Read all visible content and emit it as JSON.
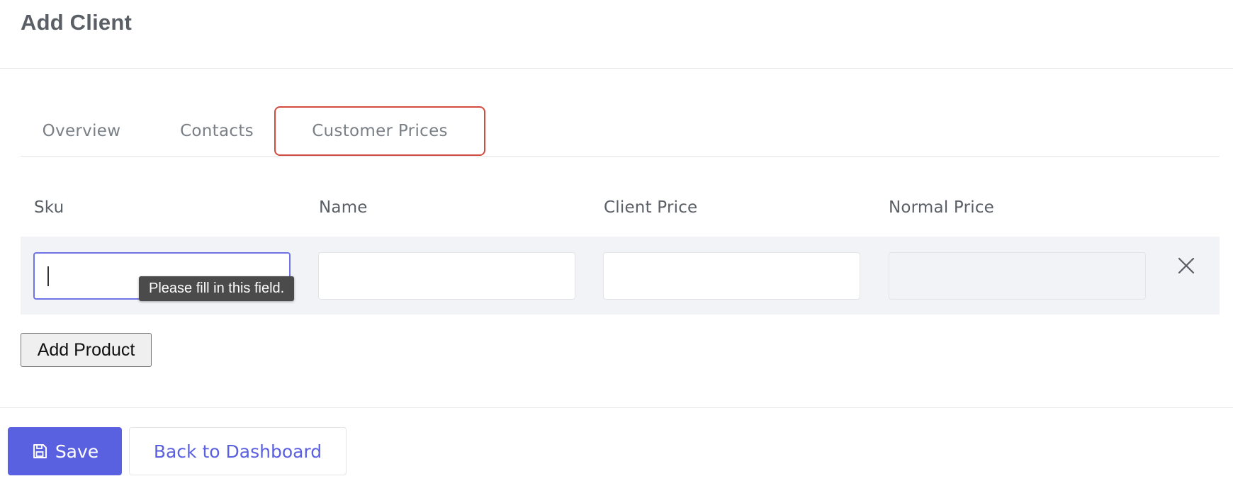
{
  "header": {
    "title": "Add Client"
  },
  "tabs": [
    {
      "label": "Overview"
    },
    {
      "label": "Contacts"
    },
    {
      "label": "Customer Prices",
      "highlighted": true
    }
  ],
  "table": {
    "columns": [
      "Sku",
      "Name",
      "Client Price",
      "Normal Price"
    ],
    "rows": [
      {
        "sku": "",
        "name": "",
        "client_price": "",
        "normal_price": ""
      }
    ]
  },
  "validation": {
    "tooltip": "Please fill in this field."
  },
  "actions": {
    "add_product": "Add Product",
    "save": "Save",
    "back": "Back to Dashboard"
  },
  "icons": {
    "remove": "close-icon",
    "save": "floppy-disk-icon"
  },
  "colors": {
    "primary": "#5961e0",
    "tab_highlight": "#d24b3f",
    "focus_border": "#6f73e6"
  }
}
